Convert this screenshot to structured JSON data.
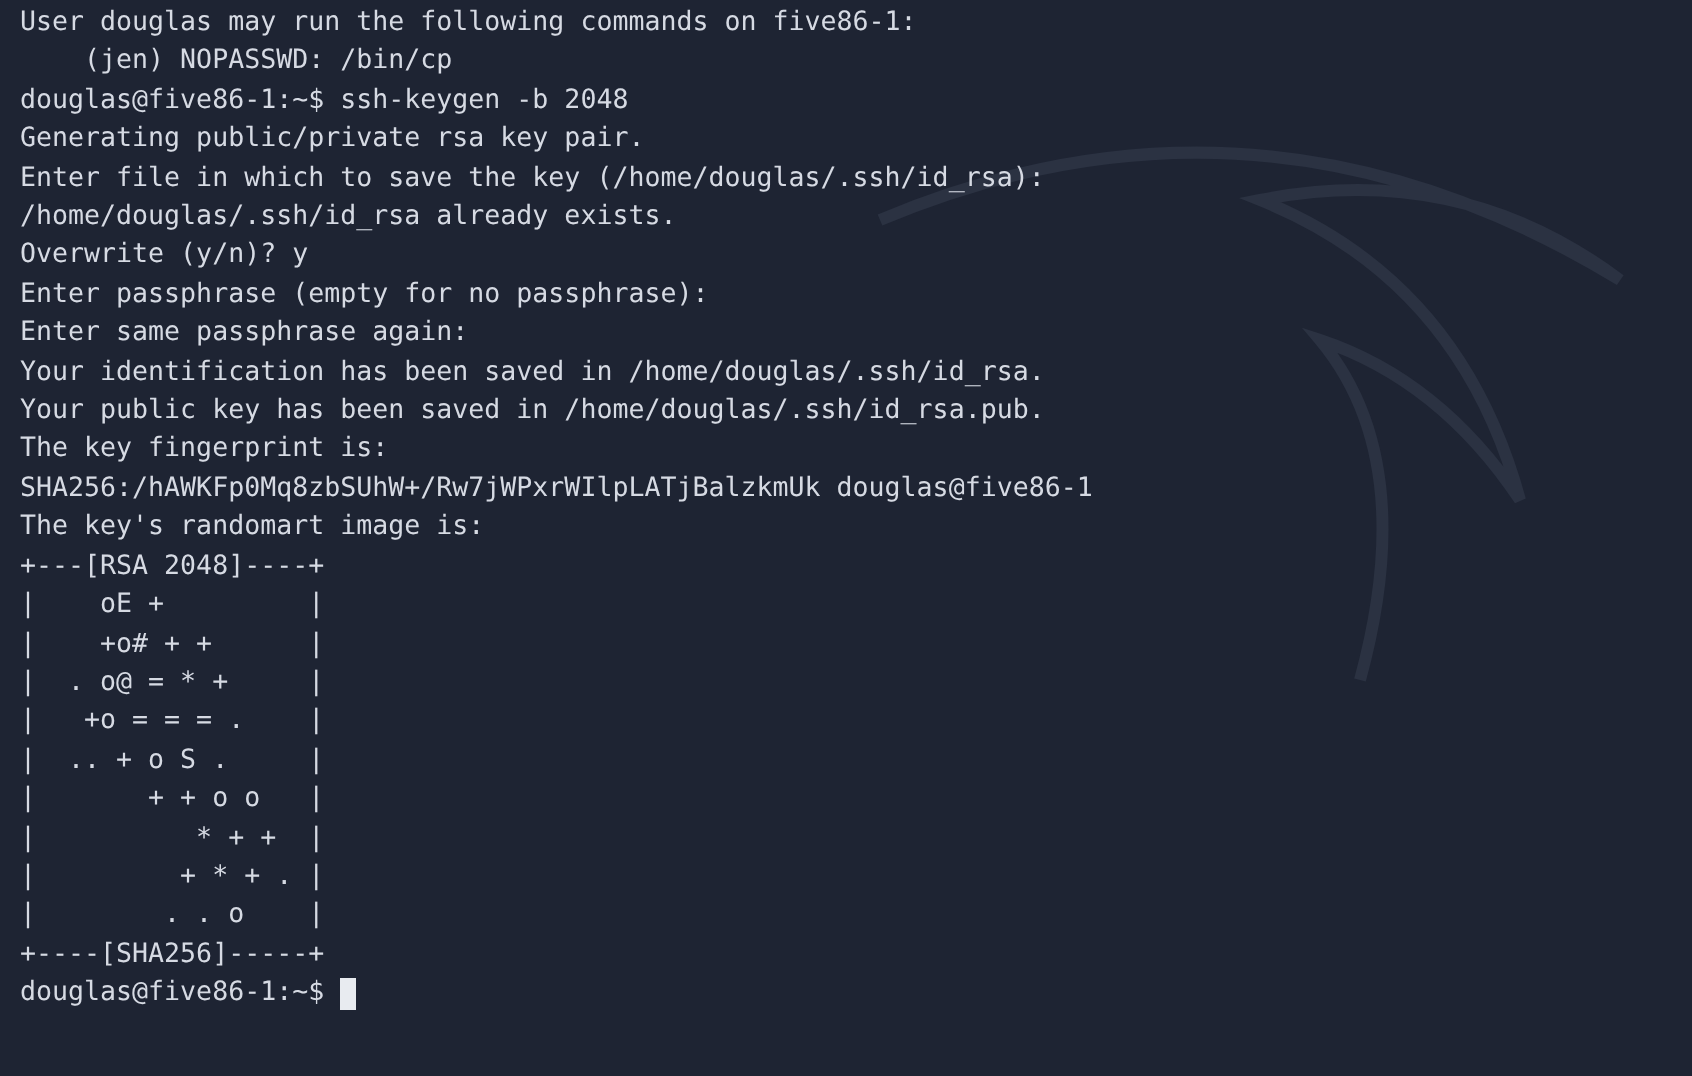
{
  "terminal": {
    "lines": [
      "User douglas may run the following commands on five86-1:",
      "    (jen) NOPASSWD: /bin/cp",
      "douglas@five86-1:~$ ssh-keygen -b 2048",
      "Generating public/private rsa key pair.",
      "Enter file in which to save the key (/home/douglas/.ssh/id_rsa):",
      "/home/douglas/.ssh/id_rsa already exists.",
      "Overwrite (y/n)? y",
      "Enter passphrase (empty for no passphrase):",
      "Enter same passphrase again:",
      "Your identification has been saved in /home/douglas/.ssh/id_rsa.",
      "Your public key has been saved in /home/douglas/.ssh/id_rsa.pub.",
      "The key fingerprint is:",
      "SHA256:/hAWKFp0Mq8zbSUhW+/Rw7jWPxrWIlpLATjBalzkmUk douglas@five86-1",
      "The key's randomart image is:",
      "+---[RSA 2048]----+",
      "|    oE +         |",
      "|    +o# + +      |",
      "|  . o@ = * +     |",
      "|   +o = = = .    |",
      "|  .. + o S .     |",
      "|       + + o o   |",
      "|          * + +  |",
      "|         + * + . |",
      "|        . . o    |",
      "+----[SHA256]-----+"
    ],
    "prompt": {
      "text": "douglas@five86-1:~$",
      "cursor": true
    }
  }
}
